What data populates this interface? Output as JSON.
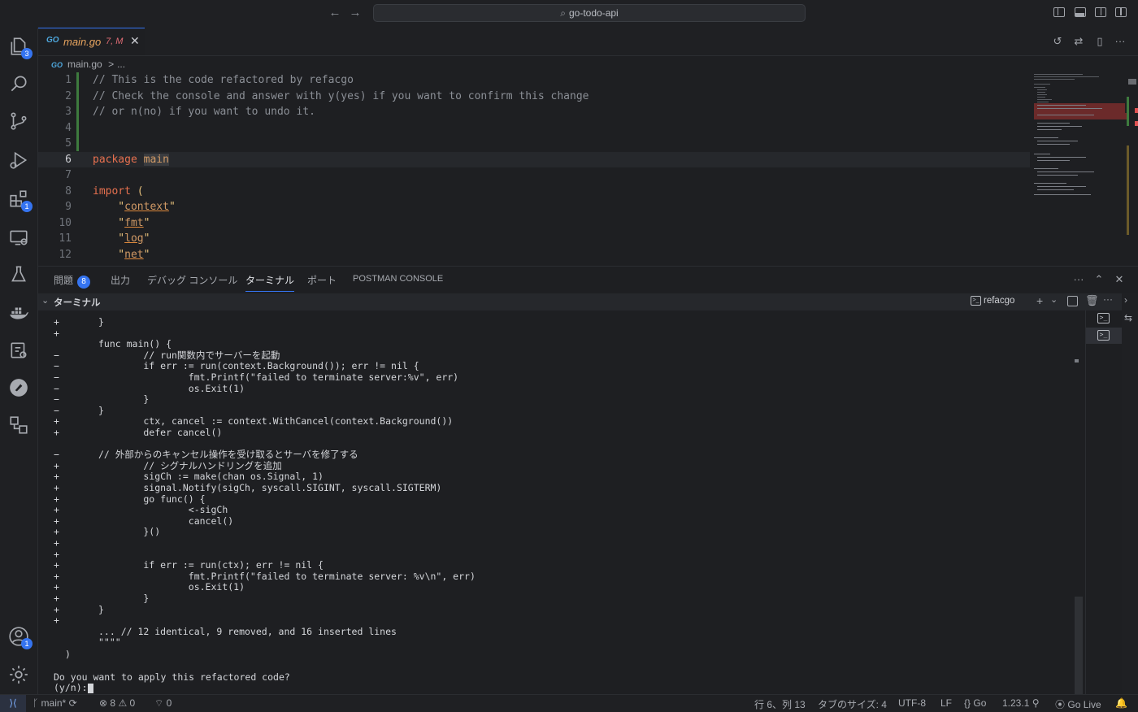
{
  "titlebar": {
    "search_text": "go-todo-api"
  },
  "activity_bar": {
    "explorer_badge": "3",
    "extensions_badge": "1",
    "accounts_badge": "1"
  },
  "editor": {
    "tab": {
      "filename": "main.go",
      "meta": "7, M",
      "icon_text": "GO"
    },
    "breadcrumb": {
      "file": "main.go",
      "sep": ">",
      "more": "..."
    },
    "lines": [
      {
        "n": "1",
        "text": "// This is the code refactored by refacgo"
      },
      {
        "n": "2",
        "text": "// Check the console and answer with y(yes) if you want to confirm this change"
      },
      {
        "n": "3",
        "text": "// or n(no) if you want to undo it."
      },
      {
        "n": "4",
        "text": ""
      },
      {
        "n": "5",
        "text": ""
      },
      {
        "n": "6",
        "kw": "package",
        "name": "main"
      },
      {
        "n": "7",
        "text": ""
      },
      {
        "n": "8",
        "kw": "import",
        "paren": "("
      },
      {
        "n": "9",
        "pkg": "context"
      },
      {
        "n": "10",
        "pkg": "fmt"
      },
      {
        "n": "11",
        "pkg": "log"
      },
      {
        "n": "12",
        "pkg": "net"
      }
    ]
  },
  "panel": {
    "tabs": [
      {
        "label": "問題",
        "badge": "8"
      },
      {
        "label": "出力"
      },
      {
        "label": "デバッグ コンソール"
      },
      {
        "label": "ターミナル"
      },
      {
        "label": "ポート"
      },
      {
        "label": "POSTMAN CONSOLE"
      }
    ],
    "terminal_title": "ターミナル",
    "terminal_name": "refacgo",
    "terminal_lines": [
      {
        "m": "+",
        "t": "}"
      },
      {
        "m": "+",
        "t": ""
      },
      {
        "m": "",
        "t": "func main() {"
      },
      {
        "m": "−",
        "t": "        // run関数内でサーバーを起動"
      },
      {
        "m": "−",
        "t": "        if err := run(context.Background()); err != nil {"
      },
      {
        "m": "−",
        "t": "                fmt.Printf(\"failed to terminate server:%v\", err)"
      },
      {
        "m": "−",
        "t": "                os.Exit(1)"
      },
      {
        "m": "−",
        "t": "        }"
      },
      {
        "m": "−",
        "t": "}"
      },
      {
        "m": "+",
        "t": "        ctx, cancel := context.WithCancel(context.Background())"
      },
      {
        "m": "+",
        "t": "        defer cancel()"
      },
      {
        "m": "",
        "t": ""
      },
      {
        "m": "−",
        "t": "// 外部からのキャンセル操作を受け取るとサーバを修了する"
      },
      {
        "m": "+",
        "t": "        // シグナルハンドリングを追加"
      },
      {
        "m": "+",
        "t": "        sigCh := make(chan os.Signal, 1)"
      },
      {
        "m": "+",
        "t": "        signal.Notify(sigCh, syscall.SIGINT, syscall.SIGTERM)"
      },
      {
        "m": "+",
        "t": "        go func() {"
      },
      {
        "m": "+",
        "t": "                <-sigCh"
      },
      {
        "m": "+",
        "t": "                cancel()"
      },
      {
        "m": "+",
        "t": "        }()"
      },
      {
        "m": "+",
        "t": ""
      },
      {
        "m": "+",
        "t": ""
      },
      {
        "m": "+",
        "t": "        if err := run(ctx); err != nil {"
      },
      {
        "m": "+",
        "t": "                fmt.Printf(\"failed to terminate server: %v\\n\", err)"
      },
      {
        "m": "+",
        "t": "                os.Exit(1)"
      },
      {
        "m": "+",
        "t": "        }"
      },
      {
        "m": "+",
        "t": "}"
      },
      {
        "m": "+",
        "t": ""
      },
      {
        "m": "",
        "t": "... // 12 identical, 9 removed, and 16 inserted lines"
      },
      {
        "m": "",
        "t": "\"\"\"\""
      }
    ],
    "closing_paren": ")",
    "prompt_question": "Do you want to apply this refactored code?",
    "prompt_input": "(y/n):"
  },
  "statusbar": {
    "branch": "main*",
    "errors": "8",
    "warnings": "0",
    "ports": "0",
    "cursor": "行 6、列 13",
    "tab_size": "タブのサイズ: 4",
    "encoding": "UTF-8",
    "eol": "LF",
    "language": "Go",
    "go_version": "1.23.1",
    "live": "Go Live"
  },
  "colors": {
    "accent": "#3574f0",
    "go_blue": "#4ea8de",
    "modified": "#e8a55f"
  }
}
